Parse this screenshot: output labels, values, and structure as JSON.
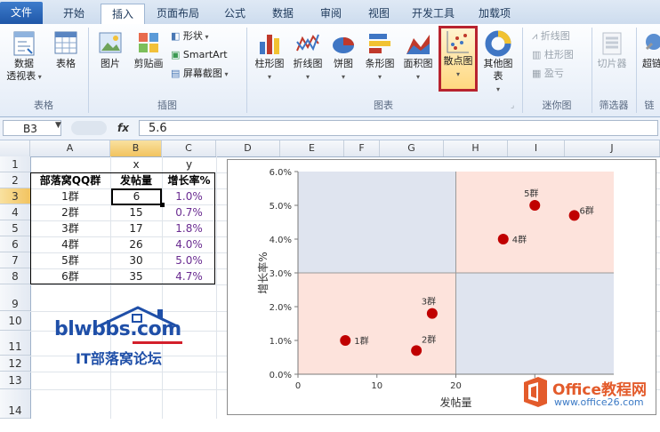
{
  "ribbon": {
    "tabs": [
      "文件",
      "开始",
      "插入",
      "页面布局",
      "公式",
      "数据",
      "审阅",
      "视图",
      "开发工具",
      "加载项"
    ],
    "active_tab": "插入",
    "groups": {
      "table": {
        "label": "表格",
        "buttons": {
          "pivot": "数据",
          "pivot2": "透视表",
          "table": "表格"
        }
      },
      "illus": {
        "label": "插图",
        "buttons": {
          "picture": "图片",
          "clipart": "剪贴画",
          "shapes": "形状",
          "smartart": "SmartArt",
          "screenshot": "屏幕截图"
        }
      },
      "charts": {
        "label": "图表",
        "buttons": {
          "column": "柱形图",
          "line": "折线图",
          "pie": "饼图",
          "bar": "条形图",
          "area": "面积图",
          "scatter": "散点图",
          "other": "其他图表"
        }
      },
      "spark": {
        "label": "迷你图",
        "buttons": {
          "line": "折线图",
          "column": "柱形图",
          "winloss": "盈亏"
        }
      },
      "filter": {
        "label": "筛选器",
        "buttons": {
          "slicer": "切片器"
        }
      },
      "links": {
        "label": "链",
        "buttons": {
          "hyperlink": "超链"
        }
      }
    }
  },
  "formula_bar": {
    "name_box": "B3",
    "fx": "fx",
    "value": "5.6"
  },
  "columns": [
    "A",
    "B",
    "C",
    "D",
    "E",
    "F",
    "G",
    "H",
    "I",
    "J"
  ],
  "rows": [
    "1",
    "2",
    "3",
    "4",
    "5",
    "6",
    "7",
    "8",
    "9",
    "10",
    "11",
    "12",
    "13",
    "14"
  ],
  "sheet": {
    "row1": {
      "b": "x",
      "c": "y"
    },
    "headers": [
      "部落窝QQ群",
      "发帖量",
      "增长率%"
    ],
    "data": [
      [
        "1群",
        "6",
        "1.0%"
      ],
      [
        "2群",
        "15",
        "0.7%"
      ],
      [
        "3群",
        "17",
        "1.8%"
      ],
      [
        "4群",
        "26",
        "4.0%"
      ],
      [
        "5群",
        "30",
        "5.0%"
      ],
      [
        "6群",
        "35",
        "4.7%"
      ]
    ]
  },
  "chart_data": {
    "type": "scatter",
    "xlabel": "发帖量",
    "ylabel": "增长率%",
    "xlim": [
      0,
      40
    ],
    "ylim": [
      0,
      0.06
    ],
    "x_ticks": [
      "0",
      "10",
      "20",
      "30"
    ],
    "y_ticks": [
      "0.0%",
      "1.0%",
      "2.0%",
      "3.0%",
      "4.0%",
      "5.0%",
      "6.0%"
    ],
    "points": [
      {
        "label": "1群",
        "x": 6,
        "y": 0.01
      },
      {
        "label": "2群",
        "x": 15,
        "y": 0.007
      },
      {
        "label": "3群",
        "x": 17,
        "y": 0.018
      },
      {
        "label": "4群",
        "x": 26,
        "y": 0.04
      },
      {
        "label": "5群",
        "x": 30,
        "y": 0.05
      },
      {
        "label": "6群",
        "x": 35,
        "y": 0.047
      }
    ],
    "quadrant_split": {
      "x": 20,
      "y": 0.03
    },
    "colors": {
      "point": "#c00000",
      "quad_pink": "#fde3dc",
      "quad_blue": "#dfe4ef"
    }
  },
  "logos": {
    "blw_domain": "blwbbs.com",
    "blw_sub": "IT部落窝论坛",
    "office_name": "Office教程网",
    "office_url": "www.office26.com"
  }
}
